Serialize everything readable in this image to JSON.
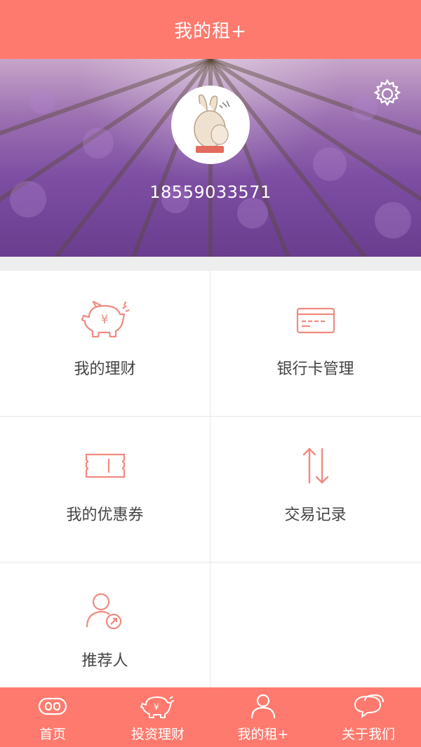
{
  "header": {
    "title": "我的租+"
  },
  "profile": {
    "phone": "18559033571",
    "settings_icon": "gear-icon",
    "avatar_icon": "rabbit-avatar"
  },
  "menu": {
    "items": [
      {
        "label": "我的理财",
        "icon": "piggy-bank-icon"
      },
      {
        "label": "银行卡管理",
        "icon": "bank-card-icon"
      },
      {
        "label": "我的优惠券",
        "icon": "coupon-icon"
      },
      {
        "label": "交易记录",
        "icon": "transfer-arrows-icon"
      },
      {
        "label": "推荐人",
        "icon": "referrer-icon"
      }
    ]
  },
  "tabbar": {
    "tabs": [
      {
        "label": "首页",
        "icon": "home-icon"
      },
      {
        "label": "投资理财",
        "icon": "invest-icon"
      },
      {
        "label": "我的租+",
        "icon": "user-icon"
      },
      {
        "label": "关于我们",
        "icon": "chat-icon"
      }
    ]
  },
  "colors": {
    "accent": "#ff7a6e",
    "icon_line": "#f08a80",
    "separator": "#eeeeee"
  }
}
